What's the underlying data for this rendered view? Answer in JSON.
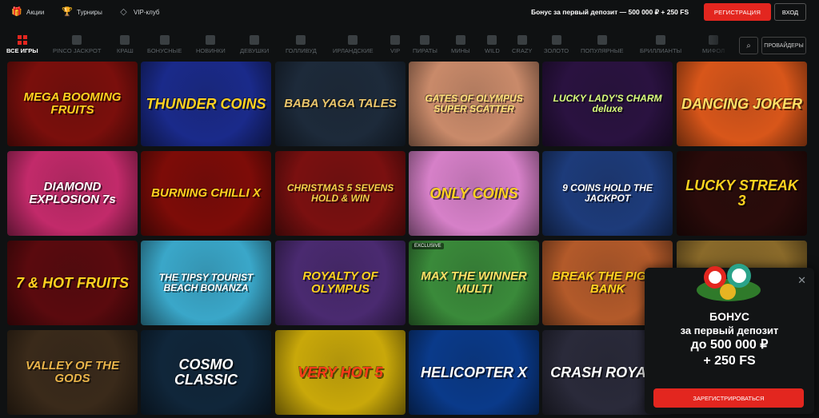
{
  "header": {
    "links": [
      {
        "label": "Акции",
        "icon": "gift-icon"
      },
      {
        "label": "Турниры",
        "icon": "trophy-icon"
      },
      {
        "label": "VIP-клуб",
        "icon": "diamond-icon"
      }
    ],
    "bonus_text": "Бонус за первый депозит — 500 000 ₽ + 250 FS",
    "register_label": "РЕГИСТРАЦИЯ",
    "login_label": "ВХОД"
  },
  "nav": {
    "items": [
      {
        "label": "ВСЕ ИГРЫ",
        "active": true
      },
      {
        "label": "PINCO JACKPOT"
      },
      {
        "label": "КРАШ"
      },
      {
        "label": "БОНУСНЫЕ"
      },
      {
        "label": "НОВИНКИ"
      },
      {
        "label": "ДЕВУШКИ"
      },
      {
        "label": "ГОЛЛИВУД"
      },
      {
        "label": "ИРЛАНДСКИЕ"
      },
      {
        "label": "VIP"
      },
      {
        "label": "ПИРАТЫ"
      },
      {
        "label": "МИНЫ"
      },
      {
        "label": "WILD"
      },
      {
        "label": "CRAZY"
      },
      {
        "label": "ЗОЛОТО"
      },
      {
        "label": "ПОПУЛЯРНЫЕ"
      },
      {
        "label": "БРИЛЛИАНТЫ"
      },
      {
        "label": "МИФОЛ"
      }
    ],
    "providers_label": "ПРОВАЙДЕРЫ"
  },
  "games": [
    {
      "title": "MEGA BOOMING FRUITS",
      "bg": "#7a0f0c",
      "fg": "#ffd21f"
    },
    {
      "title": "THUNDER COINS",
      "bg": "#1a2a8a",
      "fg": "#ffd21f"
    },
    {
      "title": "BABA YAGA TALES",
      "bg": "#1d2a3a",
      "fg": "#e9c46a"
    },
    {
      "title": "GATES OF OLYMPUS SUPER SCATTER",
      "bg": "#c98a6a",
      "fg": "#ffe27a"
    },
    {
      "title": "LUCKY LADY'S CHARM deluxe",
      "bg": "#2a1240",
      "fg": "#d8ff7a"
    },
    {
      "title": "DANCING JOKER",
      "bg": "#d8561a",
      "fg": "#ffe066"
    },
    {
      "title": "DIAMOND EXPLOSION 7s",
      "bg": "#c22a6a",
      "fg": "#ffffff"
    },
    {
      "title": "BURNING CHILLI X",
      "bg": "#7d0c08",
      "fg": "#ffd21f"
    },
    {
      "title": "CHRISTMAS 5 SEVENS HOLD & WIN",
      "bg": "#7a1010",
      "fg": "#f3d04a"
    },
    {
      "title": "ONLY COINS",
      "bg": "#d680c8",
      "fg": "#ffd21f"
    },
    {
      "title": "9 COINS HOLD THE JACKPOT",
      "bg": "#1d3b7a",
      "fg": "#ffffff"
    },
    {
      "title": "LUCKY STREAK 3",
      "bg": "#2a0b0a",
      "fg": "#ffd21f"
    },
    {
      "title": "7 & HOT FRUITS",
      "bg": "#5a0a0e",
      "fg": "#ffd21f"
    },
    {
      "title": "THE TIPSY TOURIST BEACH BONANZA",
      "bg": "#3aa7c9",
      "fg": "#ffffff"
    },
    {
      "title": "ROYALTY OF OLYMPUS",
      "bg": "#4a2a70",
      "fg": "#ffd21f"
    },
    {
      "title": "MAX THE WINNER MULTI",
      "bg": "#3a8a3a",
      "fg": "#ffe066",
      "badge": "EXCLUSIVE"
    },
    {
      "title": "BREAK THE PIGGY BANK",
      "bg": "#b35a2a",
      "fg": "#ffd21f"
    },
    {
      "title": "",
      "bg": "#8a6a2a",
      "fg": "#ffd21f"
    },
    {
      "title": "VALLEY OF THE GODS",
      "bg": "#3a2a1a",
      "fg": "#e9b44a"
    },
    {
      "title": "COSMO CLASSIC",
      "bg": "#10263a",
      "fg": "#ffffff"
    },
    {
      "title": "VERY HOT 5",
      "bg": "#c9a80a",
      "fg": "#ff3a1a"
    },
    {
      "title": "HELICOPTER X",
      "bg": "#0a3a8a",
      "fg": "#ffffff"
    },
    {
      "title": "CRASH ROYALE",
      "bg": "#2a2a3a",
      "fg": "#ffffff"
    },
    {
      "title": "",
      "bg": "#1a1a1a",
      "fg": "#ffffff"
    }
  ],
  "popup": {
    "line1": "БОНУС",
    "line2": "за первый депозит",
    "line3": "до 500 000 ₽",
    "line4": "+ 250 FS",
    "button_label": "ЗАРЕГИСТРИРОВАТЬСЯ"
  },
  "colors": {
    "accent": "#e3261f",
    "background": "#0f1112"
  }
}
